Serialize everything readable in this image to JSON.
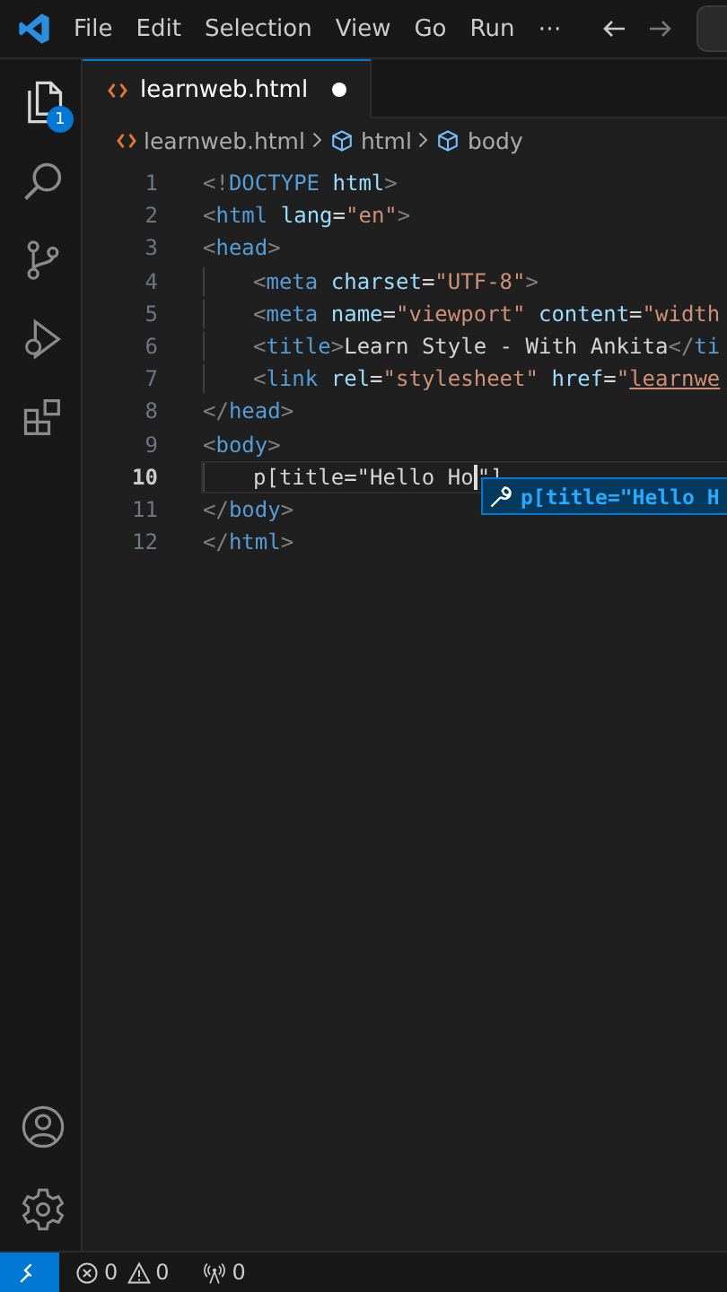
{
  "menu": [
    "File",
    "Edit",
    "Selection",
    "View",
    "Go",
    "Run",
    "⋯"
  ],
  "activity_bar": {
    "top": [
      {
        "kind": "explorer",
        "selected": true,
        "badge": "1"
      },
      {
        "kind": "search",
        "selected": false
      },
      {
        "kind": "source-control",
        "selected": false
      },
      {
        "kind": "run-debug",
        "selected": false
      },
      {
        "kind": "extensions",
        "selected": false
      }
    ],
    "bottom": [
      {
        "kind": "account"
      },
      {
        "kind": "settings"
      }
    ]
  },
  "tabs": [
    {
      "label": "learnweb.html",
      "selected": true,
      "modified": true
    }
  ],
  "breadcrumbs": [
    {
      "kind": "file",
      "label": "learnweb.html"
    },
    {
      "kind": "symbol",
      "label": "html"
    },
    {
      "kind": "symbol",
      "label": "body"
    }
  ],
  "lines": [
    {
      "number": "1",
      "indented": false,
      "current": false,
      "tokens": [
        {
          "kind": "punct",
          "text": "<!"
        },
        {
          "kind": "tag",
          "text": "DOCTYPE"
        },
        {
          "kind": "attr",
          "text": " html"
        },
        {
          "kind": "punct",
          "text": ">"
        }
      ]
    },
    {
      "number": "2",
      "indented": false,
      "current": false,
      "tokens": [
        {
          "kind": "punct",
          "text": "<"
        },
        {
          "kind": "tag",
          "text": "html"
        },
        {
          "kind": "attr",
          "text": " lang"
        },
        {
          "kind": "text",
          "text": "="
        },
        {
          "kind": "str",
          "text": "\"en\""
        },
        {
          "kind": "punct",
          "text": ">"
        }
      ]
    },
    {
      "number": "3",
      "indented": false,
      "current": false,
      "tokens": [
        {
          "kind": "punct",
          "text": "<"
        },
        {
          "kind": "tag",
          "text": "head"
        },
        {
          "kind": "punct",
          "text": ">"
        }
      ]
    },
    {
      "number": "4",
      "indented": true,
      "current": false,
      "tokens": [
        {
          "kind": "punct",
          "text": "<"
        },
        {
          "kind": "tag",
          "text": "meta"
        },
        {
          "kind": "attr",
          "text": " charset"
        },
        {
          "kind": "text",
          "text": "="
        },
        {
          "kind": "str",
          "text": "\"UTF-8\""
        },
        {
          "kind": "punct",
          "text": ">"
        }
      ]
    },
    {
      "number": "5",
      "indented": true,
      "current": false,
      "tokens": [
        {
          "kind": "punct",
          "text": "<"
        },
        {
          "kind": "tag",
          "text": "meta"
        },
        {
          "kind": "attr",
          "text": " name"
        },
        {
          "kind": "text",
          "text": "="
        },
        {
          "kind": "str",
          "text": "\"viewport\""
        },
        {
          "kind": "attr",
          "text": " content"
        },
        {
          "kind": "text",
          "text": "="
        },
        {
          "kind": "str",
          "text": "\"width"
        }
      ]
    },
    {
      "number": "6",
      "indented": true,
      "current": false,
      "tokens": [
        {
          "kind": "punct",
          "text": "<"
        },
        {
          "kind": "tag",
          "text": "title"
        },
        {
          "kind": "punct",
          "text": ">"
        },
        {
          "kind": "text",
          "text": "Learn Style - With Ankita"
        },
        {
          "kind": "punct",
          "text": "</"
        },
        {
          "kind": "tag",
          "text": "ti"
        }
      ]
    },
    {
      "number": "7",
      "indented": true,
      "current": false,
      "tokens": [
        {
          "kind": "punct",
          "text": "<"
        },
        {
          "kind": "tag",
          "text": "link"
        },
        {
          "kind": "attr",
          "text": " rel"
        },
        {
          "kind": "text",
          "text": "="
        },
        {
          "kind": "str",
          "text": "\"stylesheet\""
        },
        {
          "kind": "attr",
          "text": " href"
        },
        {
          "kind": "text",
          "text": "="
        },
        {
          "kind": "str",
          "text": "\""
        },
        {
          "kind": "link",
          "text": "learnwe"
        }
      ]
    },
    {
      "number": "8",
      "indented": false,
      "current": false,
      "tokens": [
        {
          "kind": "punct",
          "text": "</"
        },
        {
          "kind": "tag",
          "text": "head"
        },
        {
          "kind": "punct",
          "text": ">"
        }
      ]
    },
    {
      "number": "9",
      "indented": false,
      "current": false,
      "tokens": [
        {
          "kind": "punct",
          "text": "<"
        },
        {
          "kind": "tag",
          "text": "body"
        },
        {
          "kind": "punct",
          "text": ">"
        }
      ]
    },
    {
      "number": "10",
      "indented": true,
      "current": true,
      "tokens": [
        {
          "kind": "text",
          "text": "p[title=\"Hello Ho",
          "caret": true
        },
        {
          "kind": "text",
          "text": "\"]"
        }
      ]
    },
    {
      "number": "11",
      "indented": false,
      "current": false,
      "tokens": [
        {
          "kind": "punct",
          "text": "</"
        },
        {
          "kind": "tag",
          "text": "body"
        },
        {
          "kind": "punct",
          "text": ">"
        }
      ]
    },
    {
      "number": "12",
      "indented": false,
      "current": false,
      "tokens": [
        {
          "kind": "punct",
          "text": "</"
        },
        {
          "kind": "tag",
          "text": "html"
        },
        {
          "kind": "punct",
          "text": ">"
        }
      ]
    }
  ],
  "suggestion": {
    "label": "p[title=\"Hello H"
  },
  "status_bar": {
    "errors": "0",
    "warnings": "0",
    "ports": "0"
  }
}
